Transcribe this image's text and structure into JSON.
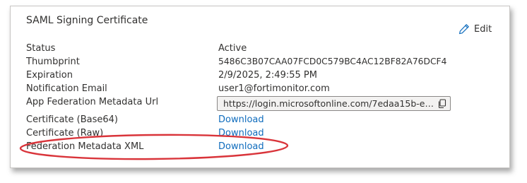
{
  "card": {
    "title": "SAML Signing Certificate",
    "edit_label": "Edit"
  },
  "fields": [
    {
      "label": "Status",
      "value": "Active"
    },
    {
      "label": "Thumbprint",
      "value": "5486C3B07CAA07FCD0C579BC4AC12BF82A76DCF4"
    },
    {
      "label": "Expiration",
      "value": "2/9/2025, 2:49:55 PM"
    },
    {
      "label": "Notification Email",
      "value": "user1@fortimonitor.com"
    },
    {
      "label": "App Federation Metadata Url",
      "value": "https://login.microsoftonline.com/7edaa15b-eed2..."
    },
    {
      "label": "Certificate (Base64)",
      "value": "Download"
    },
    {
      "label": "Certificate (Raw)",
      "value": "Download"
    },
    {
      "label": "Federation Metadata XML",
      "value": "Download"
    }
  ],
  "colors": {
    "link": "#0f6cbd",
    "highlight_oval": "#d9343a"
  }
}
